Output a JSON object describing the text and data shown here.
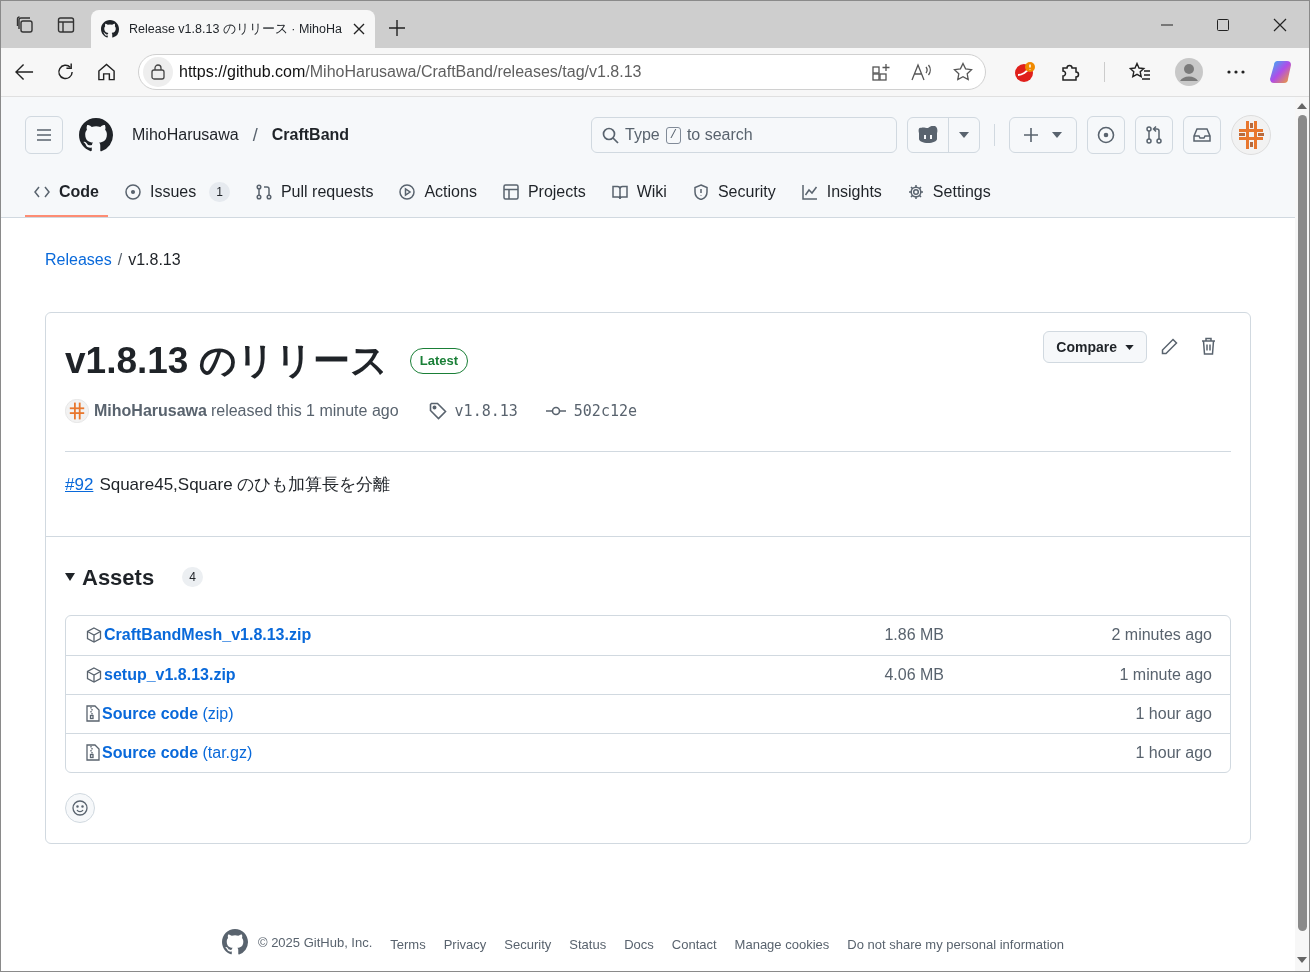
{
  "browser": {
    "tab": {
      "title": "Release v1.8.13 のリリース · MihoHa"
    },
    "url_host": "https://github.com",
    "url_path": "/MihoHarusawa/CraftBand/releases/tag/v1.8.13"
  },
  "header": {
    "owner": "MihoHarusawa",
    "separator": "/",
    "repo": "CraftBand",
    "search": {
      "before": "Type",
      "key": "/",
      "after": "to search"
    }
  },
  "nav_tabs": [
    {
      "label": "Code",
      "selected": true
    },
    {
      "label": "Issues",
      "count": "1",
      "selected": false
    },
    {
      "label": "Pull requests",
      "selected": false
    },
    {
      "label": "Actions",
      "selected": false
    },
    {
      "label": "Projects",
      "selected": false
    },
    {
      "label": "Wiki",
      "selected": false
    },
    {
      "label": "Security",
      "selected": false
    },
    {
      "label": "Insights",
      "selected": false
    },
    {
      "label": "Settings",
      "selected": false
    }
  ],
  "breadcrumb": {
    "link": "Releases",
    "separator": "/",
    "current": "v1.8.13"
  },
  "release": {
    "title": "v1.8.13 のリリース",
    "badge": "Latest",
    "compare": "Compare",
    "author": "MihoHarusawa",
    "released": "released this 1 minute ago",
    "tag": "v1.8.13",
    "commit": "502c12e",
    "notes": {
      "issue": "#92",
      "text": "Square45,Square のひも加算長を分離"
    },
    "assets": {
      "heading": "Assets",
      "count": "4",
      "expanded": true,
      "items": [
        {
          "kind": "package",
          "name": "CraftBandMesh_v1.8.13.zip",
          "size": "1.86 MB",
          "time": "2 minutes ago"
        },
        {
          "kind": "package",
          "name": "setup_v1.8.13.zip",
          "size": "4.06 MB",
          "time": "1 minute ago"
        },
        {
          "kind": "source",
          "name": "Source code",
          "suffix": "(zip)",
          "time": "1 hour ago"
        },
        {
          "kind": "source",
          "name": "Source code",
          "suffix": "(tar.gz)",
          "time": "1 hour ago"
        }
      ]
    }
  },
  "footer": {
    "copyright": "© 2025 GitHub, Inc.",
    "links": [
      "Terms",
      "Privacy",
      "Security",
      "Status",
      "Docs",
      "Contact",
      "Manage cookies",
      "Do not share my personal information"
    ]
  }
}
